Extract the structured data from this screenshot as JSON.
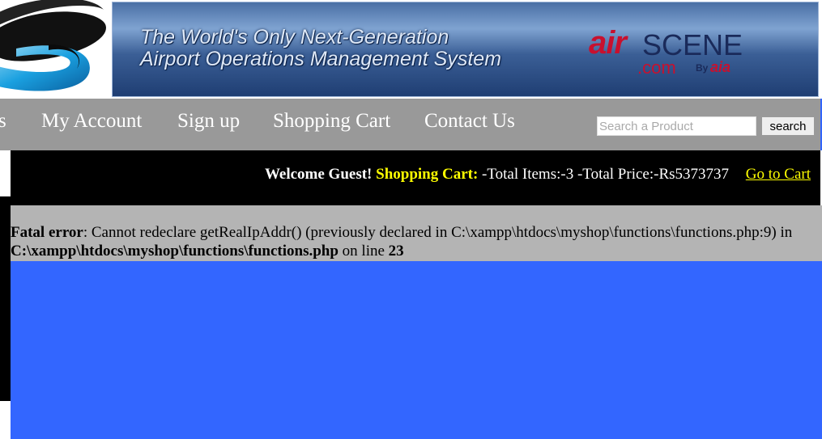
{
  "banner": {
    "tagline_line1": "The World's Only Next-Generation",
    "tagline_line2": "Airport Operations Management System",
    "brand_air": "air",
    "brand_scene": "SCENE",
    "brand_com": ".com",
    "brand_by": "By",
    "brand_mark": "aia"
  },
  "nav": {
    "items": [
      {
        "label": "s"
      },
      {
        "label": "My Account"
      },
      {
        "label": "Sign up"
      },
      {
        "label": "Shopping Cart"
      },
      {
        "label": "Contact Us"
      }
    ],
    "search_placeholder": "Search a Product",
    "search_button": "search"
  },
  "cart_bar": {
    "welcome": "Welcome Guest!",
    "cart_label": "Shopping Cart:",
    "totals": "-Total Items:-3 -Total Price:-Rs5373737",
    "link": "Go to Cart"
  },
  "error": {
    "label": "Fatal error",
    "message": ": Cannot redeclare getRealIpAddr() (previously declared in C:\\xampp\\htdocs\\myshop\\functions\\functions.php:9) in ",
    "file": "C:\\xampp\\htdocs\\myshop\\functions\\functions.php",
    "line_text": " on line ",
    "line_number": "23"
  },
  "colors": {
    "nav_bg": "#999999",
    "bar_bg": "#000000",
    "highlight": "#ffff00",
    "content_gray": "#b4b4b4",
    "content_blue": "#3366ff"
  },
  "icons": {
    "logo": "swirl-logo-icon"
  }
}
